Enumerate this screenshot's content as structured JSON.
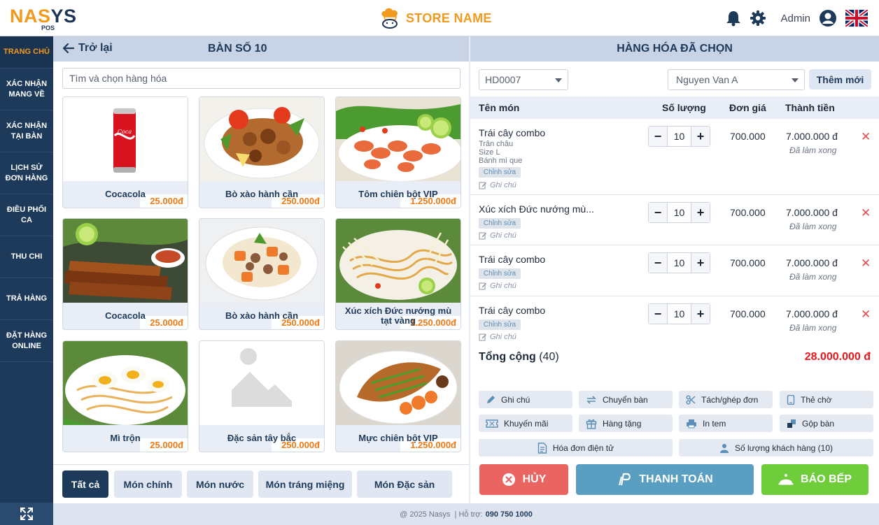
{
  "header": {
    "logo_left": "NA",
    "logo_s": "S",
    "logo_right": "YS",
    "logo_sub": "POS",
    "store_name": "STORE NAME",
    "user": "Admin"
  },
  "sidebar": {
    "items": [
      {
        "label": "TRANG CHỦ",
        "active": true
      },
      {
        "label": "XÁC NHẬN MANG VỀ"
      },
      {
        "label": "XÁC NHẬN TẠI BÀN"
      },
      {
        "label": "LỊCH SỬ ĐƠN HÀNG"
      },
      {
        "label": "ĐIỀU PHỐI CA"
      },
      {
        "label": "THU CHI"
      },
      {
        "label": "TRẢ HÀNG"
      },
      {
        "label": "ĐẶT HÀNG ONLINE"
      }
    ]
  },
  "left": {
    "back_label": "Trở lại",
    "table_title": "BÀN SỐ 10",
    "search_placeholder": "Tìm và chọn hàng hóa"
  },
  "products": [
    {
      "name": "Cocacola",
      "price": "25.000đ",
      "img": "coke"
    },
    {
      "name": "Bò xào hành cần",
      "price": "250.000đ",
      "img": "skewer"
    },
    {
      "name": "Tôm chiên bột VIP",
      "price": "1.250.000đ",
      "img": "shrimp"
    },
    {
      "name": "Cocacola",
      "price": "25.000đ",
      "img": "bbq"
    },
    {
      "name": "Bò xào hành cần",
      "price": "250.000đ",
      "img": "stew"
    },
    {
      "name": "Xúc xích Đức nướng mù tạt vàng",
      "price": "1.250.000đ",
      "img": "noodle"
    },
    {
      "name": "Mì trộn",
      "price": "25.000đ",
      "img": "egg"
    },
    {
      "name": "Đặc sản tây bắc",
      "price": "250.000đ",
      "img": "placeholder"
    },
    {
      "name": "Mực chiên bột VIP",
      "price": "1.250.000đ",
      "img": "fish"
    }
  ],
  "categories": [
    {
      "label": "Tất cả",
      "active": true
    },
    {
      "label": "Món chính"
    },
    {
      "label": "Món nước"
    },
    {
      "label": "Món tráng miệng"
    },
    {
      "label": "Món Đặc sản"
    }
  ],
  "right": {
    "title": "HÀNG HÓA ĐÃ CHỌN",
    "order_id": "HD0007",
    "customer": "Nguyen Van A",
    "new_label": "Thêm mới",
    "columns": [
      "Tên món",
      "Số lượng",
      "Đơn giá",
      "Thành tiền"
    ],
    "items": [
      {
        "name": "Trái cây combo",
        "options": [
          "Trân châu",
          "Size L",
          "Bánh mì que"
        ],
        "edit": "Chỉnh sửa",
        "note": "Ghi chú",
        "qty": "10",
        "price": "700.000",
        "total": "7.000.000 đ",
        "status": "Đã làm xong"
      },
      {
        "name": "Xúc xích Đức nướng mù...",
        "options": [],
        "edit": "Chỉnh sửa",
        "note": "Ghi chú",
        "qty": "10",
        "price": "700.000",
        "total": "7.000.000 đ",
        "status": "Đã làm xong"
      },
      {
        "name": "Trái cây combo",
        "options": [],
        "edit": "Chỉnh sửa",
        "note": "Ghi chú",
        "qty": "10",
        "price": "700.000",
        "total": "7.000.000 đ",
        "status": "Đã làm xong"
      },
      {
        "name": "Trái cây combo",
        "options": [],
        "edit": "Chỉnh sửa",
        "note": "Ghi chú",
        "qty": "10",
        "price": "700.000",
        "total": "7.000.000 đ",
        "status": "Đã làm xong"
      }
    ],
    "summary_label": "Tổng cộng",
    "summary_count": "(40)",
    "summary_total": "28.000.000 đ",
    "actions": {
      "note": "Ghi chú",
      "move_table": "Chuyển bàn",
      "split_merge": "Tách/ghép đơn",
      "wait_card": "Thẻ chờ",
      "promotion": "Khuyến mãi",
      "gift": "Hàng tặng",
      "print_label": "In tem",
      "merge_table": "Gộp bàn",
      "e_invoice": "Hóa đơn điện tử",
      "guest_count": "Số lượng khách hàng (10)"
    },
    "cancel": "HỦY",
    "pay": "THANH TOÁN",
    "kitchen": "BÁO BẾP"
  },
  "footer": {
    "copyright": "@ 2025 Nasys",
    "support_label": "| Hỗ trợ:",
    "phone": "090 750 1000"
  },
  "colors": {
    "navy": "#1e3a5b",
    "orange": "#f29a1f",
    "red": "#ea6461",
    "blue": "#5a9fc2",
    "green": "#6fcd3c"
  }
}
